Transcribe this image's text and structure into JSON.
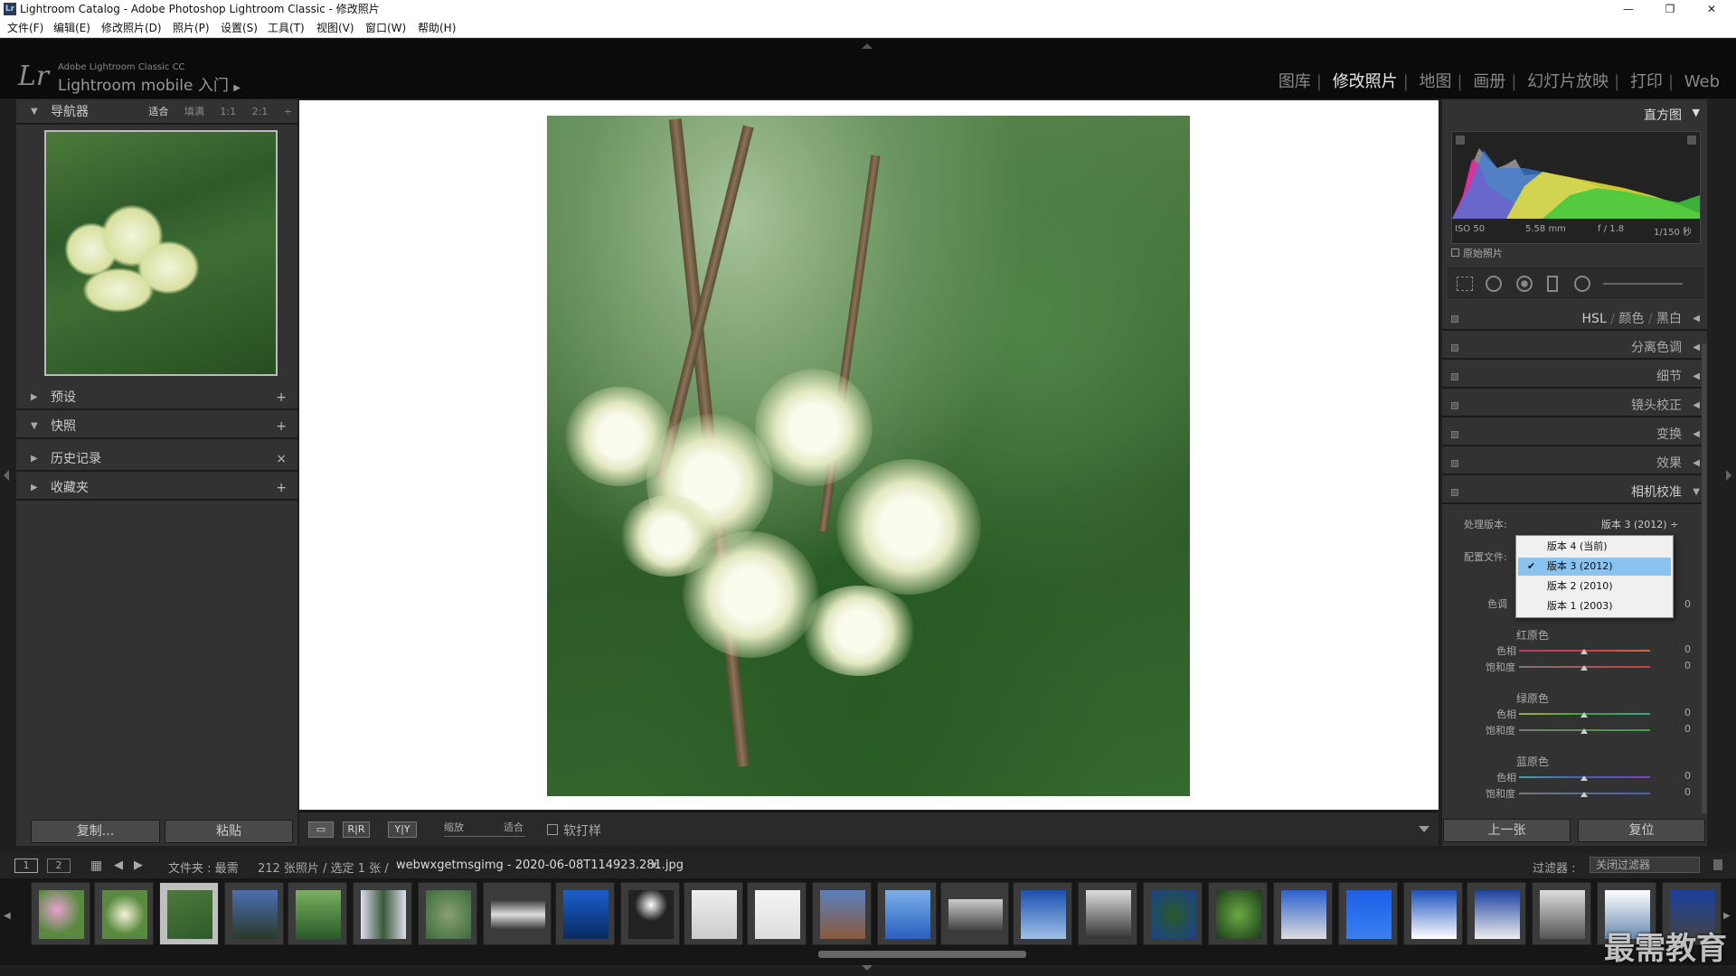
{
  "window": {
    "title": "Lightroom Catalog - Adobe Photoshop Lightroom Classic - 修改照片",
    "icon": "Lr",
    "controls": [
      "minimize-icon",
      "restore-icon",
      "close-icon"
    ]
  },
  "menu": [
    "文件(F)",
    "编辑(E)",
    "修改照片(D)",
    "照片(P)",
    "设置(S)",
    "工具(T)",
    "视图(V)",
    "窗口(W)",
    "帮助(H)"
  ],
  "brand": {
    "logo": "Lr",
    "small": "Adobe Lightroom Classic CC",
    "big": "Lightroom mobile 入门",
    "arrow": "▶"
  },
  "modules": [
    "图库",
    "修改照片",
    "地图",
    "画册",
    "幻灯片放映",
    "打印",
    "Web"
  ],
  "active_module": "修改照片",
  "left": {
    "navigator": {
      "title": "导航器",
      "options": [
        "适合",
        "填满",
        "1:1",
        "2:1"
      ],
      "active": "适合"
    },
    "sections": [
      {
        "label": "预设",
        "action": "+",
        "arrow": "▶"
      },
      {
        "label": "快照",
        "action": "+",
        "arrow": "▼"
      },
      {
        "label": "历史记录",
        "action": "×",
        "arrow": "▶"
      },
      {
        "label": "收藏夹",
        "action": "+",
        "arrow": "▶"
      }
    ],
    "copy": "复制...",
    "paste": "粘贴"
  },
  "toolbar": {
    "zoom_label": "缩放",
    "zoom_value": "适合",
    "softproof": "软打样"
  },
  "right": {
    "histogram_title": "直方图",
    "meta": {
      "iso": "ISO 50",
      "focal": "5.58 mm",
      "aperture": "f / 1.8",
      "shutter": "1/150 秒"
    },
    "original": "原始照片",
    "hsl": [
      "HSL",
      "/",
      "颜色",
      "/",
      "黑白"
    ],
    "sections": [
      "分离色调",
      "细节",
      "镜头校正",
      "变换",
      "效果",
      "相机校准"
    ],
    "process_label": "处理版本:",
    "process_value": "版本 3 (2012) ÷",
    "profile_label": "配置文件:",
    "tint_label": "色调",
    "tint_value": "0",
    "red": {
      "title": "红原色",
      "hue": "色相",
      "sat": "饱和度",
      "hue_v": "0",
      "sat_v": "0"
    },
    "green": {
      "title": "绿原色",
      "hue": "色相",
      "sat": "饱和度",
      "hue_v": "0",
      "sat_v": "0"
    },
    "blue": {
      "title": "蓝原色",
      "hue": "色相",
      "sat": "饱和度",
      "hue_v": "0",
      "sat_v": "0"
    },
    "prev": "上一张",
    "reset": "复位"
  },
  "dropdown": {
    "items": [
      "版本 4 (当前)",
      "版本 3 (2012)",
      "版本 2 (2010)",
      "版本 1 (2003)"
    ],
    "selected": 1
  },
  "filmbar": {
    "page1": "1",
    "page2": "2",
    "folder": "文件夹 : 最需",
    "count": "212 张照片 / 选定 1 张 /",
    "filename": "webwxgetmsgimg - 2020-06-08T114923.281.jpg",
    "filter_label": "过滤器 :",
    "filter_value": "关闭过滤器"
  },
  "watermark": "最需教育",
  "accent": "#88c3f2"
}
